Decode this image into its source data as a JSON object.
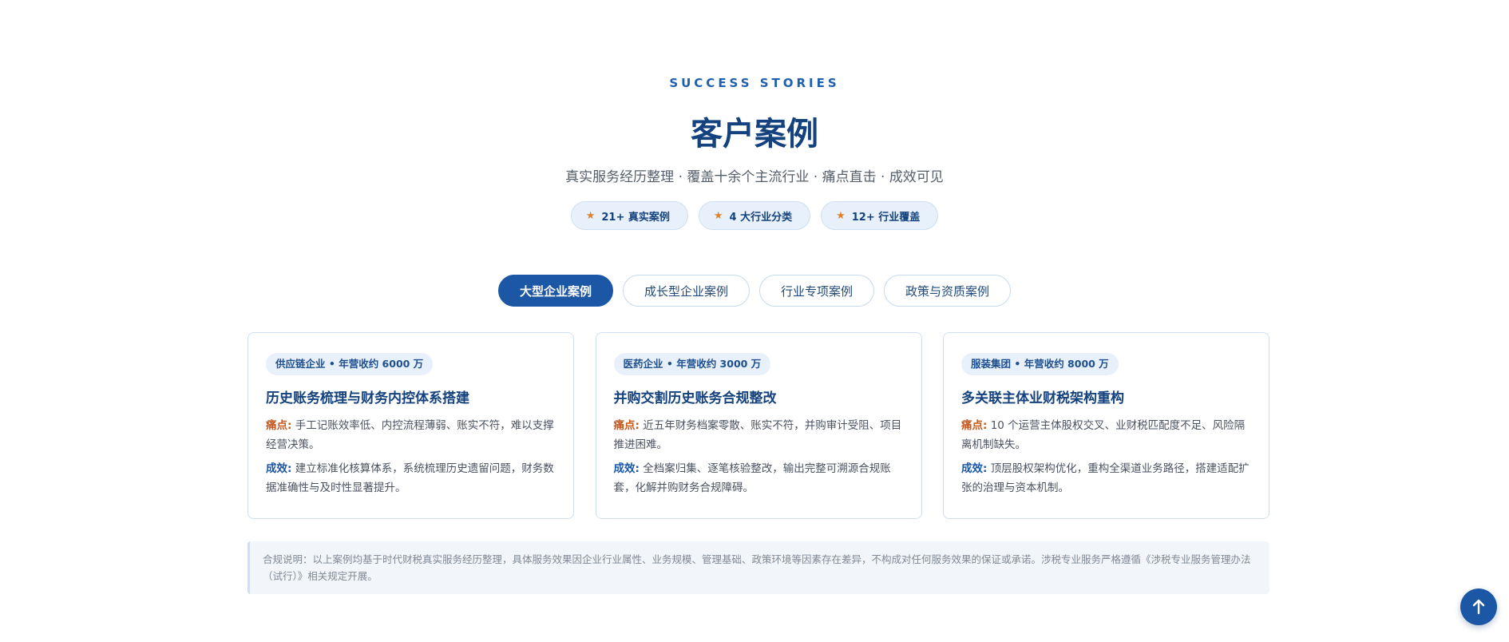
{
  "header": {
    "eyebrow": "SUCCESS STORIES",
    "title": "客户案例",
    "subtitle": "真实服务经历整理 · 覆盖十余个主流行业 · 痛点直击 · 成效可见"
  },
  "stats": [
    {
      "icon": "star-icon",
      "label": "21+ 真实案例"
    },
    {
      "icon": "star-icon",
      "label": "4 大行业分类"
    },
    {
      "icon": "star-icon",
      "label": "12+ 行业覆盖"
    }
  ],
  "tabs": [
    {
      "label": "大型企业案例",
      "active": true
    },
    {
      "label": "成长型企业案例",
      "active": false
    },
    {
      "label": "行业专项案例",
      "active": false
    },
    {
      "label": "政策与资质案例",
      "active": false
    }
  ],
  "cards": [
    {
      "tag": "供应链企业 • 年营收约 6000 万",
      "title": "历史账务梳理与财务内控体系搭建",
      "pain_label": "痛点:",
      "pain": "手工记账效率低、内控流程薄弱、账实不符，难以支撑经营决策。",
      "result_label": "成效:",
      "result": "建立标准化核算体系，系统梳理历史遗留问题，财务数据准确性与及时性显著提升。"
    },
    {
      "tag": "医药企业 • 年营收约 3000 万",
      "title": "并购交割历史账务合规整改",
      "pain_label": "痛点:",
      "pain": "近五年财务档案零散、账实不符，并购审计受阻、项目推进困难。",
      "result_label": "成效:",
      "result": "全档案归集、逐笔核验整改，输出完整可溯源合规账套，化解并购财务合规障碍。"
    },
    {
      "tag": "服装集团 • 年营收约 8000 万",
      "title": "多关联主体业财税架构重构",
      "pain_label": "痛点:",
      "pain": "10 个运营主体股权交叉、业财税匹配度不足、风险隔离机制缺失。",
      "result_label": "成效:",
      "result": "顶层股权架构优化，重构全渠道业务路径，搭建适配扩张的治理与资本机制。"
    }
  ],
  "notice": "合规说明：以上案例均基于时代财税真实服务经历整理，具体服务效果因企业行业属性、业务规模、管理基础、政策环境等因素存在差异，不构成对任何服务效果的保证或承诺。涉税专业服务严格遵循《涉税专业服务管理办法（试行）》相关规定开展。",
  "back_to_top_icon": "arrow-up-icon",
  "colors": {
    "primary": "#1c57a5",
    "title": "#14427e",
    "pain": "#c4581f",
    "star": "#e0822c"
  }
}
